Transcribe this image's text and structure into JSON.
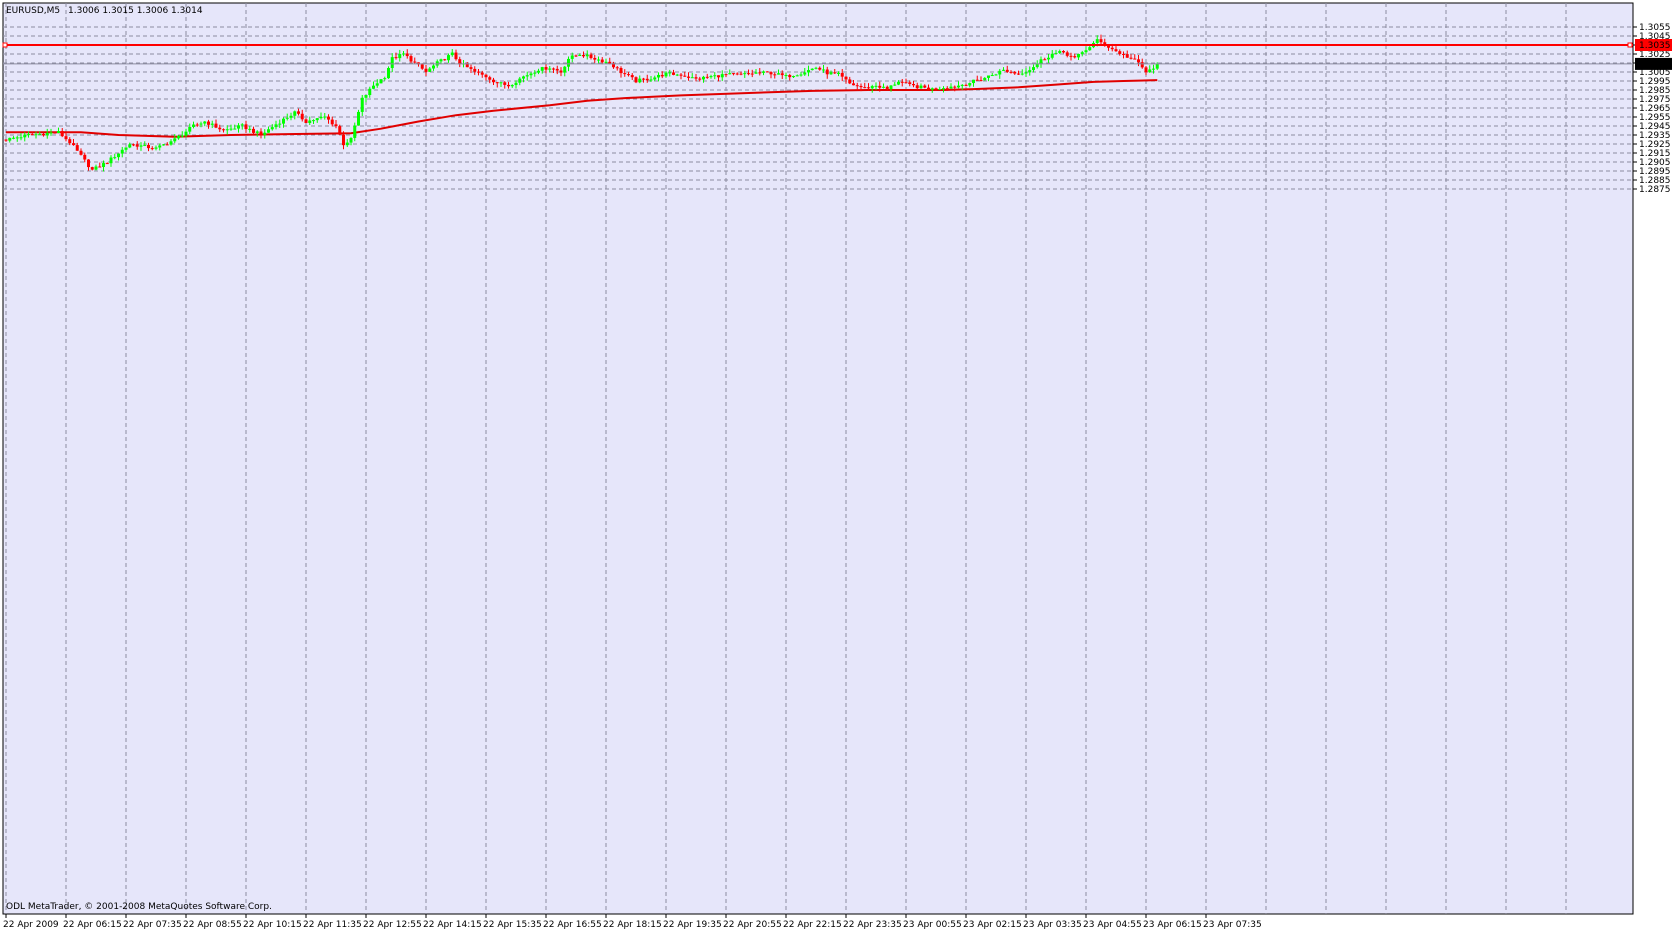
{
  "header": {
    "symbol": "EURUSD,M5",
    "ohlc": "1.3006 1.3015 1.3006 1.3014"
  },
  "footer": {
    "copyright": "ODL MetaTrader, © 2001-2008 MetaQuotes Software Corp."
  },
  "colors": {
    "background": "#E6E6FA",
    "grid": "#8C8CA0",
    "bull": "#00FF00",
    "bear": "#FF0000",
    "moving_average": "#E00000",
    "horizontal_line": "#FF0000",
    "bid_line": "#8C8CA0"
  },
  "chart_data": {
    "type": "candlestick",
    "symbol": "EURUSD",
    "timeframe": "M5",
    "grid": true,
    "ylim": [
      1.287,
      1.3063
    ],
    "y_ticks": [
      "1.3055",
      "1.3045",
      "1.3035",
      "1.3025",
      "1.3015",
      "1.3005",
      "1.2995",
      "1.2985",
      "1.2975",
      "1.2965",
      "1.2955",
      "1.2945",
      "1.2935",
      "1.2925",
      "1.2915",
      "1.2905",
      "1.2895",
      "1.2885",
      "1.2875"
    ],
    "x_ticks": [
      "22 Apr 2009",
      "22 Apr 06:15",
      "22 Apr 07:35",
      "22 Apr 08:55",
      "22 Apr 10:15",
      "22 Apr 11:35",
      "22 Apr 12:55",
      "22 Apr 14:15",
      "22 Apr 15:35",
      "22 Apr 16:55",
      "22 Apr 18:15",
      "22 Apr 19:35",
      "22 Apr 20:55",
      "22 Apr 22:15",
      "22 Apr 23:35",
      "23 Apr 00:55",
      "23 Apr 02:15",
      "23 Apr 03:35",
      "23 Apr 04:55",
      "23 Apr 06:15",
      "23 Apr 07:35"
    ],
    "bars_per_x_tick": 16,
    "current_price": "1.3014",
    "horizontal_line": {
      "price": "1.3035"
    },
    "close_path": [
      [
        0,
        1.293
      ],
      [
        6,
        1.2935
      ],
      [
        14,
        1.2938
      ],
      [
        17,
        1.2927
      ],
      [
        23,
        1.2896
      ],
      [
        27,
        1.2905
      ],
      [
        33,
        1.2925
      ],
      [
        40,
        1.292
      ],
      [
        45,
        1.293
      ],
      [
        50,
        1.2945
      ],
      [
        53,
        1.295
      ],
      [
        58,
        1.294
      ],
      [
        63,
        1.2945
      ],
      [
        68,
        1.2935
      ],
      [
        72,
        1.2947
      ],
      [
        77,
        1.296
      ],
      [
        80,
        1.295
      ],
      [
        85,
        1.2955
      ],
      [
        88,
        1.2945
      ],
      [
        90,
        1.2925
      ],
      [
        92,
        1.293
      ],
      [
        95,
        1.2975
      ],
      [
        98,
        1.299
      ],
      [
        101,
        1.3
      ],
      [
        103,
        1.302
      ],
      [
        106,
        1.3025
      ],
      [
        109,
        1.3015
      ],
      [
        112,
        1.3005
      ],
      [
        115,
        1.3015
      ],
      [
        119,
        1.3025
      ],
      [
        121,
        1.3015
      ],
      [
        125,
        1.3005
      ],
      [
        128,
        1.3
      ],
      [
        131,
        1.2993
      ],
      [
        134,
        1.299
      ],
      [
        138,
        1.3
      ],
      [
        142,
        1.3008
      ],
      [
        145,
        1.301
      ],
      [
        148,
        1.3005
      ],
      [
        150,
        1.302
      ],
      [
        153,
        1.3025
      ],
      [
        157,
        1.302
      ],
      [
        161,
        1.3015
      ],
      [
        164,
        1.3005
      ],
      [
        168,
        1.2995
      ],
      [
        172,
        1.2998
      ],
      [
        176,
        1.3003
      ],
      [
        180,
        1.3002
      ],
      [
        184,
        1.2997
      ],
      [
        188,
        1.3
      ],
      [
        192,
        1.3002
      ],
      [
        196,
        1.3002
      ],
      [
        200,
        1.3004
      ],
      [
        204,
        1.3004
      ],
      [
        208,
        1.3
      ],
      [
        212,
        1.3004
      ],
      [
        216,
        1.301
      ],
      [
        219,
        1.3004
      ],
      [
        222,
        1.3002
      ],
      [
        225,
        1.2992
      ],
      [
        229,
        1.2987
      ],
      [
        232,
        1.299
      ],
      [
        235,
        1.2986
      ],
      [
        238,
        1.2995
      ],
      [
        241,
        1.299
      ],
      [
        244,
        1.2988
      ],
      [
        247,
        1.2986
      ],
      [
        250,
        1.2988
      ],
      [
        253,
        1.2989
      ],
      [
        256,
        1.2992
      ],
      [
        260,
        1.2997
      ],
      [
        263,
        1.3002
      ],
      [
        266,
        1.3007
      ],
      [
        270,
        1.3003
      ],
      [
        273,
        1.3008
      ],
      [
        276,
        1.3018
      ],
      [
        279,
        1.3025
      ],
      [
        282,
        1.3027
      ],
      [
        285,
        1.302
      ],
      [
        288,
        1.303
      ],
      [
        291,
        1.304
      ],
      [
        294,
        1.3033
      ],
      [
        296,
        1.3028
      ],
      [
        299,
        1.3022
      ],
      [
        302,
        1.3015
      ],
      [
        304,
        1.3005
      ],
      [
        306,
        1.3008
      ],
      [
        307,
        1.3014
      ]
    ],
    "moving_average_path": [
      [
        0,
        1.2938
      ],
      [
        20,
        1.2938
      ],
      [
        30,
        1.2935
      ],
      [
        45,
        1.2933
      ],
      [
        60,
        1.2935
      ],
      [
        75,
        1.2936
      ],
      [
        92,
        1.2937
      ],
      [
        100,
        1.2942
      ],
      [
        110,
        1.295
      ],
      [
        120,
        1.2957
      ],
      [
        130,
        1.2962
      ],
      [
        145,
        1.2968
      ],
      [
        155,
        1.2973
      ],
      [
        165,
        1.2976
      ],
      [
        180,
        1.2979
      ],
      [
        200,
        1.2982
      ],
      [
        215,
        1.2984
      ],
      [
        230,
        1.2985
      ],
      [
        250,
        1.2985
      ],
      [
        258,
        1.2986
      ],
      [
        270,
        1.2988
      ],
      [
        280,
        1.2991
      ],
      [
        290,
        1.2994
      ],
      [
        298,
        1.2995
      ],
      [
        307,
        1.2996
      ]
    ]
  }
}
